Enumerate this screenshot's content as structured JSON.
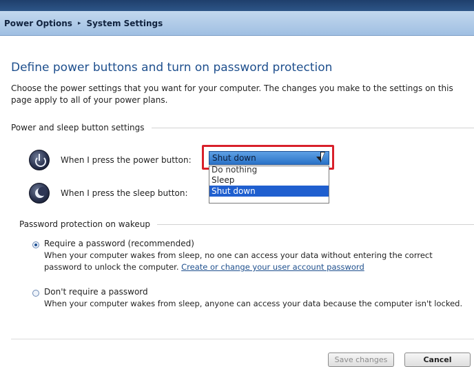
{
  "breadcrumb": {
    "items": [
      "Power Options",
      "System Settings"
    ],
    "separator": "▸"
  },
  "page": {
    "title": "Define power buttons and turn on password protection",
    "description": "Choose the power settings that you want for your computer. The changes you make to the settings on this page apply to all of your power plans."
  },
  "power_section": {
    "heading": "Power and sleep button settings",
    "power_button": {
      "label": "When I press the power button:",
      "selected": "Shut down"
    },
    "sleep_button": {
      "label": "When I press the sleep button:"
    },
    "dropdown_options": [
      "Do nothing",
      "Sleep",
      "Shut down"
    ],
    "dropdown_selected_index": 2
  },
  "password_section": {
    "heading": "Password protection on wakeup",
    "require": {
      "label": "Require a password (recommended)",
      "desc_part1": "When your computer wakes from sleep, no one can access your data without entering the correct password to unlock the computer.",
      "link": "Create or change your user account password",
      "checked": true
    },
    "dont_require": {
      "label": "Don't require a password",
      "desc": "When your computer wakes from sleep, anyone can access your data because the computer isn't locked.",
      "checked": false
    }
  },
  "footer": {
    "save_label": "Save changes",
    "cancel_label": "Cancel"
  },
  "colors": {
    "title_blue": "#1e4f8d",
    "highlight_red": "#d8202a",
    "selection_blue": "#1f5fcf"
  }
}
